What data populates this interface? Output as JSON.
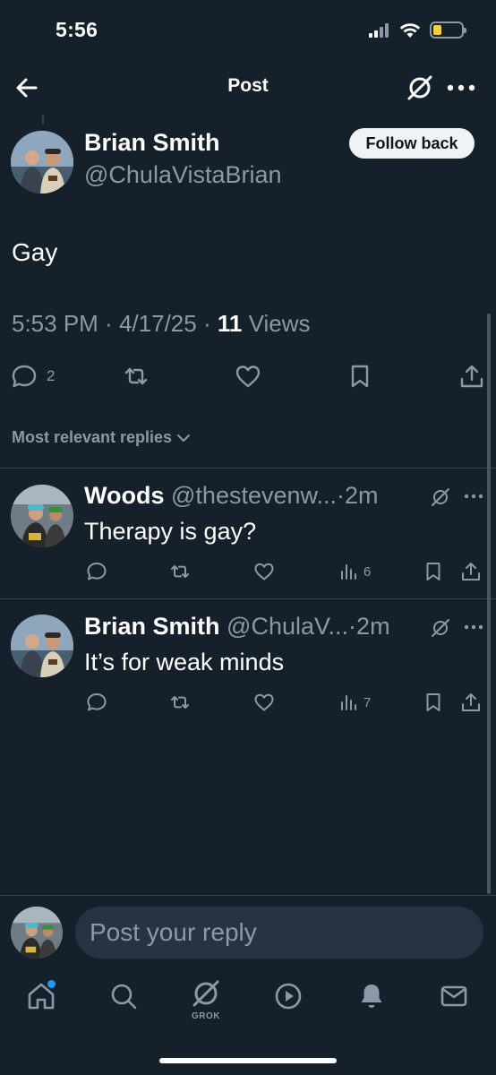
{
  "status_bar": {
    "time": "5:56"
  },
  "header": {
    "title": "Post"
  },
  "post": {
    "author_name": "Brian Smith",
    "author_handle": "@ChulaVistaBrian",
    "follow_label": "Follow back",
    "text": "Gay",
    "time": "5:53 PM",
    "date": "4/17/25",
    "views_count": "11",
    "views_label": "Views",
    "reply_count": "2",
    "separator": "·"
  },
  "replies_sort": {
    "label": "Most relevant replies"
  },
  "replies": [
    {
      "name": "Woods",
      "handle": "@thestevenw...",
      "time": "2m",
      "text": "Therapy is gay?",
      "views": "6"
    },
    {
      "name": "Brian Smith",
      "handle": "@ChulaV...",
      "time": "2m",
      "text": "It’s for weak minds",
      "views": "7"
    }
  ],
  "composer": {
    "placeholder": "Post your reply"
  },
  "tab_bar": {
    "grok_label": "GROK"
  },
  "colors": {
    "background": "#15202b",
    "secondary_text": "#8b98a5",
    "divider": "#38444d",
    "accent": "#1d9bf0",
    "battery": "#f4d03f"
  }
}
